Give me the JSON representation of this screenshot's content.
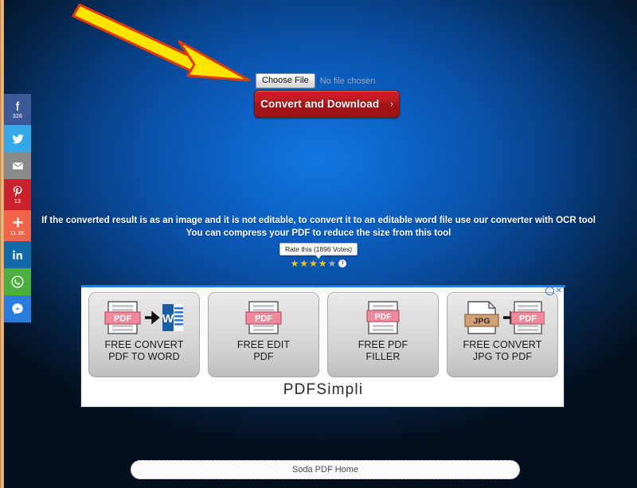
{
  "page": {
    "background_center_color": "#0c63c6",
    "background_edge_color": "#04182f"
  },
  "annotation": {
    "arrow": {
      "name": "yellow-arrow-pointer",
      "fill_color": "#FFE400",
      "outline_color": "#E23A00",
      "points_to": "choose-file-button"
    }
  },
  "social_sidebar": {
    "items": [
      {
        "network": "facebook",
        "glyph": "f",
        "count": "326",
        "color": "#3b5998"
      },
      {
        "network": "twitter",
        "glyph": "t",
        "count": "",
        "color": "#35a9e8"
      },
      {
        "network": "email",
        "glyph": "m",
        "count": "",
        "color": "#8a8a8a"
      },
      {
        "network": "pinterest",
        "glyph": "P",
        "count": "13",
        "color": "#c8232c"
      },
      {
        "network": "share",
        "glyph": "+",
        "count": "11.3K",
        "color": "#f1634a"
      },
      {
        "network": "linkedin",
        "glyph": "in",
        "count": "",
        "color": "#1269a8"
      },
      {
        "network": "whatsapp",
        "glyph": "w",
        "count": "",
        "color": "#4caf3f"
      },
      {
        "network": "messenger",
        "glyph": "M",
        "count": "",
        "color": "#2a7cdc"
      }
    ]
  },
  "uploader": {
    "choose_file_label": "Choose File",
    "no_file_text": "No file chosen",
    "convert_button_label": "Convert and Download",
    "convert_button_chevron": "›",
    "convert_button_color": "#bb1a1e"
  },
  "info": {
    "line1": "If the converted result is as an image and it is not editable, to convert it to an editable word file use our converter with OCR tool",
    "line2": "You can compress your PDF to reduce the size from this tool"
  },
  "rating": {
    "bubble_text": "Rate this (1896 Votes)",
    "votes": 1896,
    "stars_filled": 4,
    "stars_total": 5,
    "star_glyph": "★",
    "filled_color": "#f5c518",
    "empty_color": "#9fb0c2",
    "info_glyph": "i"
  },
  "ad": {
    "info_icon": "!",
    "close_icon": "✕",
    "brand": "PDFSimpli",
    "tiles": [
      {
        "label_line1": "FREE CONVERT",
        "label_line2": "PDF TO WORD",
        "icon": "pdf-to-word-icon"
      },
      {
        "label_line1": "FREE EDIT",
        "label_line2": "PDF",
        "icon": "pdf-edit-icon"
      },
      {
        "label_line1": "FREE PDF",
        "label_line2": "FILLER",
        "icon": "pdf-filler-icon"
      },
      {
        "label_line1": "FREE CONVERT",
        "label_line2": "JPG TO PDF",
        "icon": "jpg-to-pdf-icon"
      }
    ]
  },
  "bottom": {
    "label": "Soda PDF Home"
  }
}
